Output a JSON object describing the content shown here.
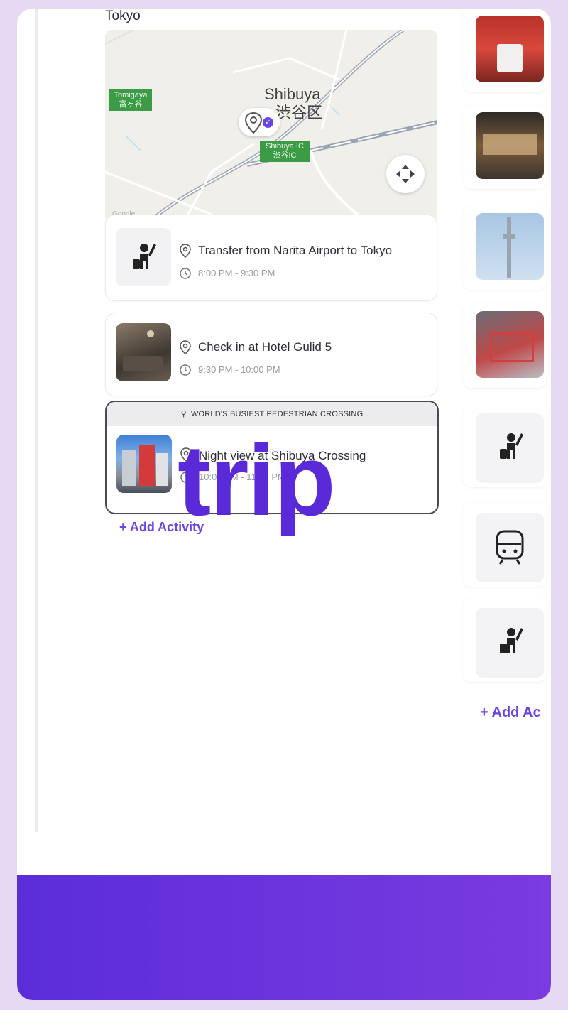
{
  "itinerary": {
    "city": "Tokyo",
    "map": {
      "district_name": "Shibuya",
      "district_name_jp": "渋谷区",
      "tag_tomigaya": "Tomigaya\n富ヶ谷",
      "tag_shibuya_ic": "Shibuya IC\n渋谷IC",
      "credit": "Google"
    },
    "activities": [
      {
        "title": "Transfer from Narita Airport to Tokyo",
        "time": "8:00 PM - 9:30 PM",
        "icon": "person-waving-icon"
      },
      {
        "title": "Check in at Hotel Gulid 5",
        "time": "9:30 PM - 10:00 PM",
        "icon": "hotel-room-photo"
      },
      {
        "tag": "WORLD'S BUSIEST PEDESTRIAN CROSSING",
        "title": "Night view at Shibuya Crossing",
        "time": "10:00 PM - 11:00 PM",
        "icon": "shibuya-crossing-photo"
      }
    ],
    "add_activity_label": "+ Add Activity"
  },
  "overlay": {
    "word": "trip"
  },
  "side_column": {
    "add_activity_label": "+ Add Ac",
    "icons": [
      "person-waving-icon",
      "train-icon",
      "person-waving-icon"
    ]
  },
  "colors": {
    "accent": "#6a45e6",
    "overlay_text": "#5a2ad8",
    "bottom_bar_start": "#5b2dd9",
    "bottom_bar_end": "#7a3be0",
    "page_background": "#e6d9f3"
  }
}
